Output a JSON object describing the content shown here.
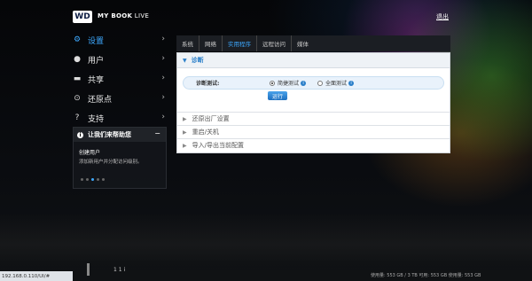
{
  "header": {
    "logo_text": "WD",
    "product_bold": "MY BOOK",
    "product_rest": " LIVE",
    "logout_label": "退出"
  },
  "nav": {
    "items": [
      {
        "label": "设置",
        "icon": "gear-icon",
        "glyph": "⚙",
        "active": true
      },
      {
        "label": "用户",
        "icon": "user-icon",
        "glyph": "👤",
        "active": false
      },
      {
        "label": "共享",
        "icon": "folder-icon",
        "glyph": "▬",
        "active": false
      },
      {
        "label": "还原点",
        "icon": "restore-icon",
        "glyph": "⊙",
        "active": false
      },
      {
        "label": "支持",
        "icon": "help-icon",
        "glyph": "?",
        "active": false
      }
    ]
  },
  "help": {
    "title": "让我们来帮助您",
    "item_title": "创建用户",
    "item_desc": "添加新用户并分配访问级别。"
  },
  "tabs": [
    {
      "label": "系统",
      "active": false
    },
    {
      "label": "网络",
      "active": false
    },
    {
      "label": "实用程序",
      "active": true
    },
    {
      "label": "远程访问",
      "active": false
    },
    {
      "label": "媒体",
      "active": false
    }
  ],
  "diagnostics": {
    "title": "诊断",
    "label": "诊断测试:",
    "option_quick": "简捷测试",
    "option_full": "全面测试",
    "selected": "quick",
    "run_label": "运行"
  },
  "sections": [
    {
      "label": "还原出厂设置"
    },
    {
      "label": "重启/关机"
    },
    {
      "label": "导入/导出当前配置"
    }
  ],
  "status": {
    "url": "192.168.0.110/UI/#",
    "mini_text": "1 1 i",
    "capacity": "使用量: 553 GB / 3 TB 可用: 553 GB 使用量: 553 GB"
  },
  "colors": {
    "accent": "#3da9ff",
    "panel_header": "#2a7fc9"
  }
}
